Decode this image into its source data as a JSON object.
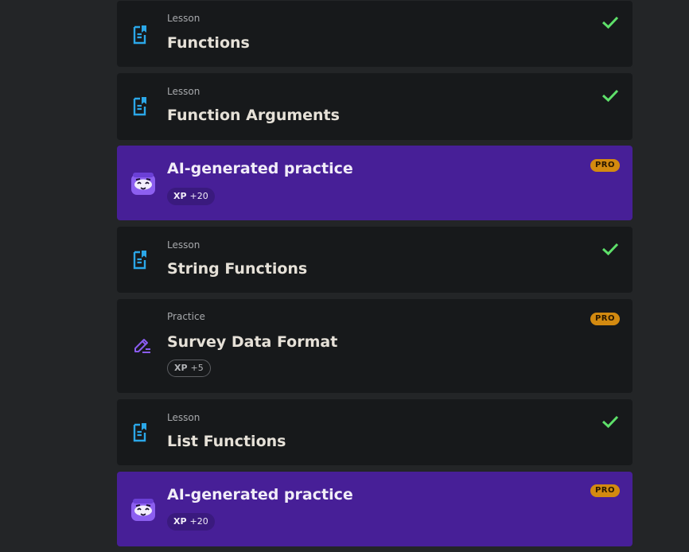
{
  "items": [
    {
      "type": "Lesson",
      "title": "Functions",
      "icon": "lesson-doc-icon",
      "status": "completed"
    },
    {
      "type": "Lesson",
      "title": "Function Arguments",
      "icon": "lesson-doc-icon",
      "status": "completed"
    },
    {
      "title": "AI-generated practice",
      "icon": "ai-mascot-icon",
      "badge": "PRO",
      "xp_label": "XP",
      "xp_value": "+20"
    },
    {
      "type": "Lesson",
      "title": "String Functions",
      "icon": "lesson-doc-icon",
      "status": "completed"
    },
    {
      "type": "Practice",
      "title": "Survey Data Format",
      "icon": "pencil-icon",
      "badge": "PRO",
      "xp_label": "XP",
      "xp_value": "+5"
    },
    {
      "type": "Lesson",
      "title": "List Functions",
      "icon": "lesson-doc-icon",
      "status": "completed"
    },
    {
      "title": "AI-generated practice",
      "icon": "ai-mascot-icon",
      "badge": "PRO",
      "xp_label": "XP",
      "xp_value": "+20"
    }
  ],
  "colors": {
    "page_bg": "#232527",
    "card_bg": "#17191b",
    "ai_card_bg": "#471f97",
    "lesson_icon": "#2ba7e8",
    "check": "#5ee06a",
    "pro_badge": "#d38a10",
    "practice_icon": "#8a5cf0"
  }
}
